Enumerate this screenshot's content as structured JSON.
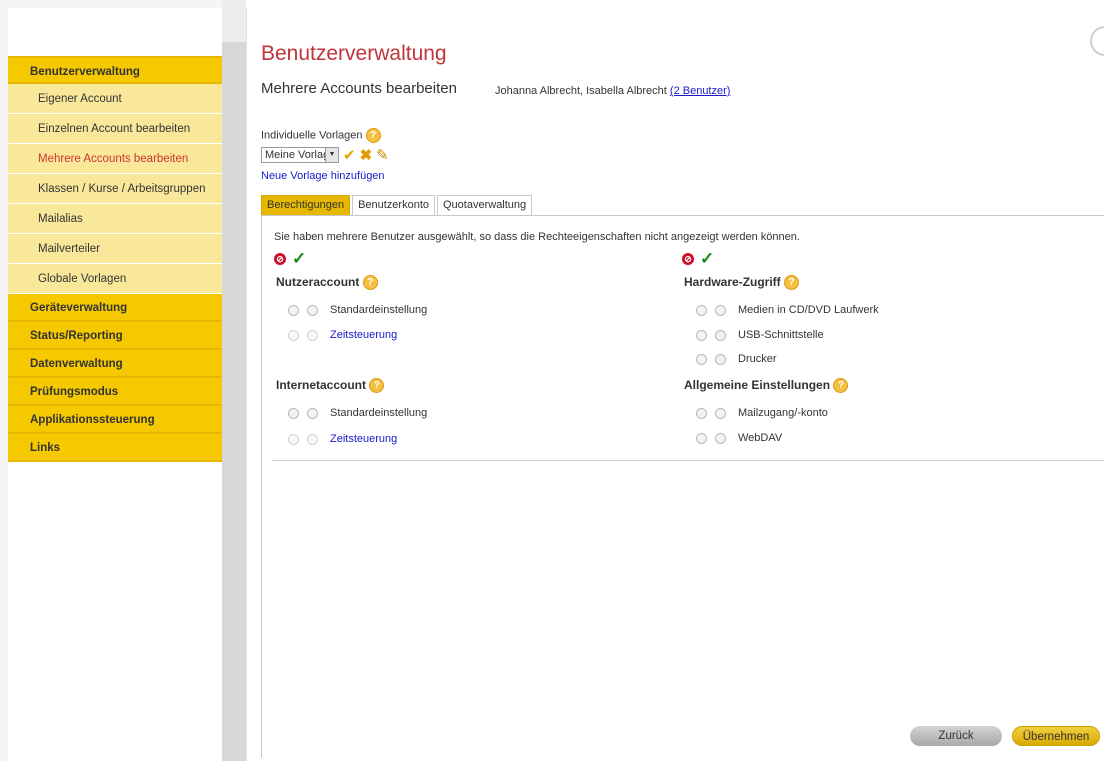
{
  "sidebar": {
    "items": [
      {
        "label": "Benutzerverwaltung",
        "type": "main"
      },
      {
        "label": "Eigener Account",
        "type": "sub"
      },
      {
        "label": "Einzelnen Account bearbeiten",
        "type": "sub"
      },
      {
        "label": "Mehrere Accounts bearbeiten",
        "type": "sub",
        "active": true
      },
      {
        "label": "Klassen / Kurse / Arbeitsgruppen",
        "type": "sub"
      },
      {
        "label": "Mailalias",
        "type": "sub"
      },
      {
        "label": "Mailverteiler",
        "type": "sub"
      },
      {
        "label": "Globale Vorlagen",
        "type": "sub"
      },
      {
        "label": "Geräteverwaltung",
        "type": "main"
      },
      {
        "label": "Status/Reporting",
        "type": "main"
      },
      {
        "label": "Datenverwaltung",
        "type": "main"
      },
      {
        "label": "Prüfungsmodus",
        "type": "main"
      },
      {
        "label": "Applikationssteuerung",
        "type": "main"
      },
      {
        "label": "Links",
        "type": "main"
      }
    ]
  },
  "header": {
    "title": "Benutzerverwaltung",
    "subtitle": "Mehrere Accounts bearbeiten",
    "users_text": "Johanna Albrecht, Isabella Albrecht",
    "users_link": "(2 Benutzer)"
  },
  "vorlagen": {
    "label": "Individuelle Vorlagen",
    "selected": "Meine Vorlage",
    "new_link": "Neue Vorlage hinzufügen"
  },
  "tabs": [
    {
      "label": "Berechtigungen",
      "active": true
    },
    {
      "label": "Benutzerkonto",
      "active": false
    },
    {
      "label": "Quotaverwaltung",
      "active": false
    }
  ],
  "panel": {
    "info": "Sie haben mehrere Benutzer ausgewählt, so dass die Rechteeigenschaften nicht angezeigt werden können.",
    "sections": {
      "nutzeraccount": {
        "title": "Nutzeraccount",
        "options": [
          "Standardeinstellung",
          "Zeitsteuerung"
        ]
      },
      "internetaccount": {
        "title": "Internetaccount",
        "options": [
          "Standardeinstellung",
          "Zeitsteuerung"
        ]
      },
      "hardware": {
        "title": "Hardware-Zugriff",
        "options": [
          "Medien in CD/DVD Laufwerk",
          "USB-Schnittstelle",
          "Drucker"
        ]
      },
      "allgemein": {
        "title": "Allgemeine Einstellungen",
        "options": [
          "Mailzugang/-konto",
          "WebDAV"
        ]
      }
    }
  },
  "buttons": {
    "back": "Zurück",
    "apply": "Übernehmen"
  },
  "colors": {
    "accent": "#f5c800",
    "title_red": "#c0343a",
    "link_blue": "#1a1acc"
  }
}
